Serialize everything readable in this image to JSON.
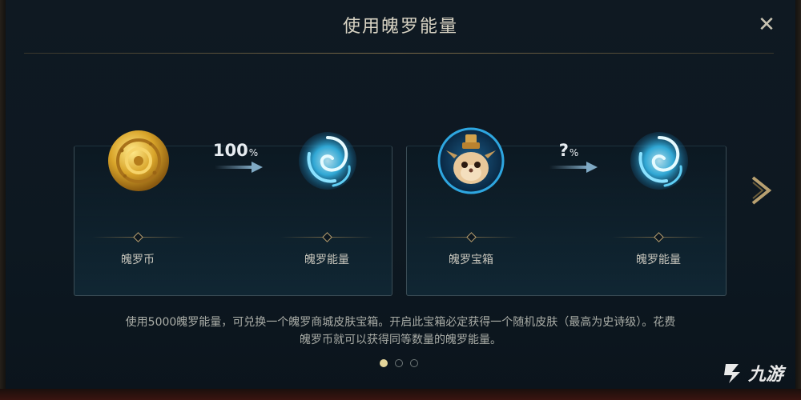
{
  "dialog": {
    "title": "使用魄罗能量",
    "close_icon": "close-icon"
  },
  "exchanges": [
    {
      "from_label": "魄罗币",
      "from_icon": "poro-coin-icon",
      "rate_value": "100",
      "rate_unit": "%",
      "to_label": "魄罗能量",
      "to_icon": "poro-energy-icon"
    },
    {
      "from_label": "魄罗宝箱",
      "from_icon": "poro-chest-icon",
      "rate_value": "?",
      "rate_unit": "%",
      "to_label": "魄罗能量",
      "to_icon": "poro-energy-icon"
    }
  ],
  "navigation": {
    "next_icon": "chevron-right-icon",
    "page_count": 3,
    "active_page": 1
  },
  "description": {
    "line1": "使用5000魄罗能量，可兑换一个魄罗商城皮肤宝箱。开启此宝箱必定获得一个随机皮肤（最高为史诗级）。花费",
    "line2": "魄罗币就可以获得同等数量的魄罗能量。"
  },
  "watermark": {
    "text": "九游"
  },
  "colors": {
    "background": "#0d1821",
    "gold_accent": "#b8a070",
    "energy_blue": "#34b7e8",
    "text_primary": "#d9d4c4",
    "text_secondary": "#a9aca6"
  }
}
